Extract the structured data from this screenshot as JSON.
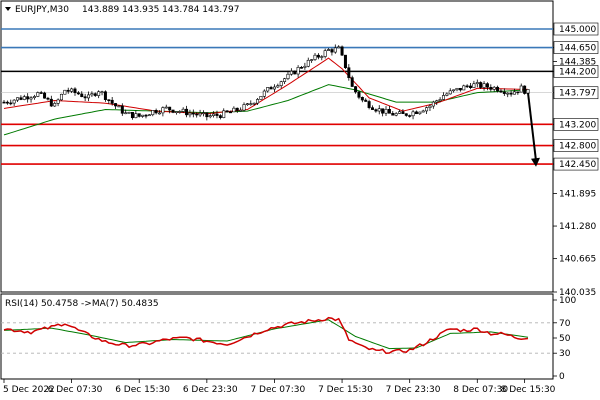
{
  "header": {
    "symbol": "EURJPY,M30",
    "ohlc": "143.889 143.935 143.784 143.797"
  },
  "rsi_header": "RSI(14) 50.4758  ->MA(7) 50.4835",
  "colors": {
    "candle": "#000000",
    "ma_fast": "#d00000",
    "ma_slow": "#007a00",
    "level_resistance": "#3a78b8",
    "level_mid": "#000000",
    "level_support": "#e00000",
    "rsi": "#d00000",
    "rsi_ma": "#007a00",
    "arrow": "#000000"
  },
  "chart_data": [
    {
      "type": "candlestick",
      "ylim": [
        140.035,
        145.17
      ],
      "y_ticks": [
        "145.000",
        "144.650",
        "144.385",
        "144.200",
        "143.797",
        "143.200",
        "142.800",
        "142.450",
        "141.895",
        "141.280",
        "140.665",
        "140.035"
      ],
      "x_ticks": [
        "5 Dec 2022",
        "6 Dec 07:30",
        "6 Dec 15:30",
        "6 Dec 23:30",
        "7 Dec 07:30",
        "7 Dec 15:30",
        "7 Dec 23:30",
        "8 Dec 07:30",
        "8 Dec 15:30"
      ],
      "levels": [
        {
          "value": 145.0,
          "label": "145.000",
          "role": "resistance"
        },
        {
          "value": 144.65,
          "label": "144.650",
          "role": "resistance"
        },
        {
          "value": 144.2,
          "label": "144.200",
          "role": "mid"
        },
        {
          "value": 143.797,
          "label": "143.797",
          "role": "current"
        },
        {
          "value": 143.2,
          "label": "143.200",
          "role": "support"
        },
        {
          "value": 142.8,
          "label": "142.800",
          "role": "support"
        },
        {
          "value": 142.45,
          "label": "142.450",
          "role": "support"
        }
      ],
      "close_anchors": [
        [
          0,
          143.62
        ],
        [
          5,
          143.7
        ],
        [
          10,
          143.78
        ],
        [
          15,
          143.55
        ],
        [
          18,
          143.85
        ],
        [
          22,
          143.78
        ],
        [
          25,
          143.7
        ],
        [
          28,
          143.85
        ],
        [
          32,
          143.6
        ],
        [
          36,
          143.4
        ],
        [
          40,
          143.35
        ],
        [
          44,
          143.45
        ],
        [
          48,
          143.5
        ],
        [
          52,
          143.45
        ],
        [
          56,
          143.4
        ],
        [
          60,
          143.35
        ],
        [
          64,
          143.38
        ],
        [
          68,
          143.45
        ],
        [
          72,
          143.55
        ],
        [
          76,
          143.75
        ],
        [
          80,
          143.95
        ],
        [
          84,
          144.1
        ],
        [
          88,
          144.3
        ],
        [
          92,
          144.45
        ],
        [
          96,
          144.6
        ],
        [
          99,
          144.62
        ],
        [
          101,
          144.3
        ],
        [
          103,
          143.9
        ],
        [
          106,
          143.65
        ],
        [
          110,
          143.5
        ],
        [
          114,
          143.4
        ],
        [
          118,
          143.38
        ],
        [
          122,
          143.45
        ],
        [
          126,
          143.55
        ],
        [
          130,
          143.75
        ],
        [
          134,
          143.85
        ],
        [
          138,
          143.95
        ],
        [
          142,
          143.92
        ],
        [
          146,
          143.88
        ],
        [
          150,
          143.8
        ],
        [
          153,
          143.88
        ],
        [
          155,
          143.8
        ]
      ],
      "ma_fast_anchors": [
        [
          0,
          143.5
        ],
        [
          15,
          143.65
        ],
        [
          30,
          143.6
        ],
        [
          45,
          143.45
        ],
        [
          60,
          143.4
        ],
        [
          72,
          143.48
        ],
        [
          84,
          143.95
        ],
        [
          96,
          144.45
        ],
        [
          100,
          144.25
        ],
        [
          108,
          143.7
        ],
        [
          118,
          143.45
        ],
        [
          128,
          143.6
        ],
        [
          140,
          143.88
        ],
        [
          155,
          143.86
        ]
      ],
      "ma_slow_anchors": [
        [
          0,
          143.0
        ],
        [
          15,
          143.3
        ],
        [
          30,
          143.48
        ],
        [
          45,
          143.45
        ],
        [
          60,
          143.42
        ],
        [
          72,
          143.45
        ],
        [
          84,
          143.65
        ],
        [
          96,
          143.95
        ],
        [
          104,
          143.85
        ],
        [
          116,
          143.62
        ],
        [
          128,
          143.62
        ],
        [
          140,
          143.8
        ],
        [
          155,
          143.85
        ]
      ],
      "forecast_arrow": {
        "from": 143.797,
        "to": 142.4
      }
    },
    {
      "type": "line",
      "title": "RSI(14)",
      "ylim": [
        0,
        100
      ],
      "y_ticks": [
        "100",
        "70",
        "50",
        "30",
        "0"
      ],
      "rsi_anchors": [
        [
          0,
          62
        ],
        [
          8,
          58
        ],
        [
          14,
          64
        ],
        [
          18,
          70
        ],
        [
          22,
          60
        ],
        [
          26,
          52
        ],
        [
          30,
          45
        ],
        [
          36,
          40
        ],
        [
          42,
          42
        ],
        [
          48,
          48
        ],
        [
          54,
          50
        ],
        [
          60,
          46
        ],
        [
          66,
          42
        ],
        [
          72,
          52
        ],
        [
          78,
          62
        ],
        [
          84,
          68
        ],
        [
          90,
          72
        ],
        [
          96,
          76
        ],
        [
          99,
          74
        ],
        [
          102,
          48
        ],
        [
          106,
          38
        ],
        [
          110,
          33
        ],
        [
          116,
          32
        ],
        [
          120,
          34
        ],
        [
          124,
          42
        ],
        [
          128,
          52
        ],
        [
          132,
          62
        ],
        [
          136,
          60
        ],
        [
          140,
          62
        ],
        [
          144,
          56
        ],
        [
          148,
          55
        ],
        [
          152,
          50
        ],
        [
          155,
          51
        ]
      ],
      "rsi_ma_anchors": [
        [
          0,
          60
        ],
        [
          14,
          63
        ],
        [
          24,
          55
        ],
        [
          36,
          44
        ],
        [
          50,
          48
        ],
        [
          66,
          46
        ],
        [
          80,
          62
        ],
        [
          96,
          74
        ],
        [
          104,
          52
        ],
        [
          114,
          36
        ],
        [
          122,
          37
        ],
        [
          132,
          56
        ],
        [
          144,
          58
        ],
        [
          155,
          51
        ]
      ]
    }
  ]
}
